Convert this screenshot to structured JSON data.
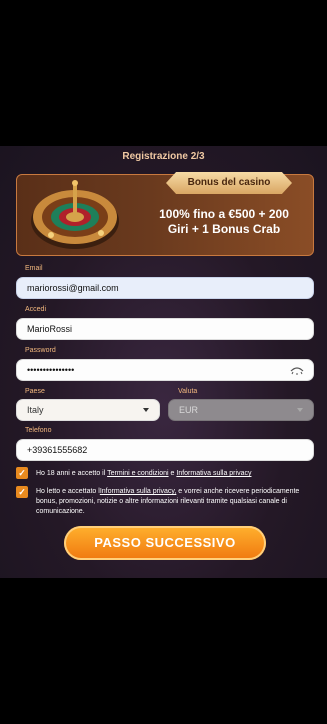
{
  "title": "Registrazione 2/3",
  "banner": {
    "badge": "Bonus del casino",
    "offer_line1": "100% fino a €500 + 200",
    "offer_line2": "Giri + 1 Bonus Crab"
  },
  "form": {
    "email": {
      "label": "Email",
      "value": "mariorossi@gmail.com"
    },
    "username": {
      "label": "Accedi",
      "value": "MarioRossi"
    },
    "password": {
      "label": "Password",
      "value": "•••••••••••••••"
    },
    "country": {
      "label": "Paese",
      "value": "Italy"
    },
    "currency": {
      "label": "Valuta",
      "value": "EUR"
    },
    "phone": {
      "label": "Telefono",
      "value": "+39361555682"
    }
  },
  "consents": {
    "age_prefix": "Ho 18 anni e accetto il ",
    "age_terms_link": "Termini e condizioni",
    "age_and": " e ",
    "age_privacy_link": "Informativa sulla privacy",
    "marketing_prefix": "Ho letto e accettato l",
    "marketing_link": "Informativa sulla privacy,",
    "marketing_suffix": " e vorrei anche ricevere periodicamente bonus, promozioni, notizie o altre informazioni rilevanti tramite qualsiasi canale di comunicazione."
  },
  "next_button": "PASSO SUCCESSIVO",
  "colors": {
    "accent": "#f0780f",
    "label": "#f3b97f",
    "background": "#241826"
  },
  "icons": [
    "roulette-image",
    "eye-icon",
    "chevron-down-icon",
    "checkmark-icon"
  ]
}
